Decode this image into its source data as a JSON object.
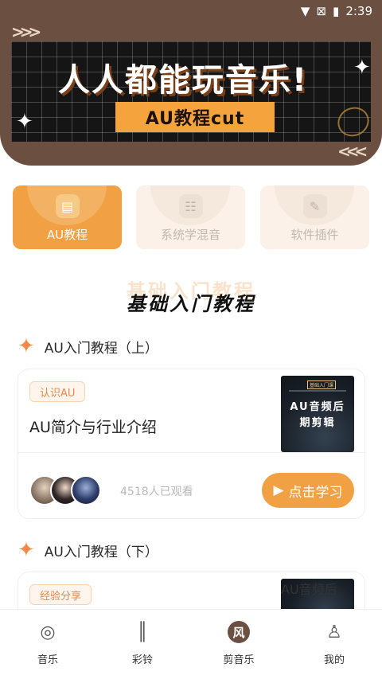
{
  "status_bar": {
    "time": "2:39",
    "icons": [
      "wifi-icon",
      "no-signal-icon",
      "battery-icon"
    ]
  },
  "banner": {
    "title": "人人都能玩音乐!",
    "subtitle": "AU教程cut",
    "colors": {
      "bg": "#6b5041",
      "accent": "#f5a33d"
    }
  },
  "categories": [
    {
      "label": "AU教程",
      "icon": "book-icon",
      "active": true
    },
    {
      "label": "系统学混音",
      "icon": "mixer-icon",
      "active": false
    },
    {
      "label": "软件插件",
      "icon": "plugin-icon",
      "active": false
    }
  ],
  "section": {
    "title": "基础入门教程"
  },
  "groups": [
    {
      "heading": "AU入门教程（上）",
      "card": {
        "tag": "认识AU",
        "title": "AU简介与行业介绍",
        "thumb_tag": "基础入门课",
        "thumb_text": "AU音频后期剪辑",
        "views": "4518人已观看",
        "button": "点击学习"
      }
    },
    {
      "heading": "AU入门教程（下）",
      "card": {
        "tag": "经验分享",
        "thumb_text": "AU音频后"
      }
    }
  ],
  "nav": [
    {
      "label": "音乐",
      "icon": "music-disc-icon"
    },
    {
      "label": "彩铃",
      "icon": "waveform-icon"
    },
    {
      "label": "剪音乐",
      "icon": "cut-music-icon",
      "active": true
    },
    {
      "label": "我的",
      "icon": "user-icon"
    }
  ]
}
